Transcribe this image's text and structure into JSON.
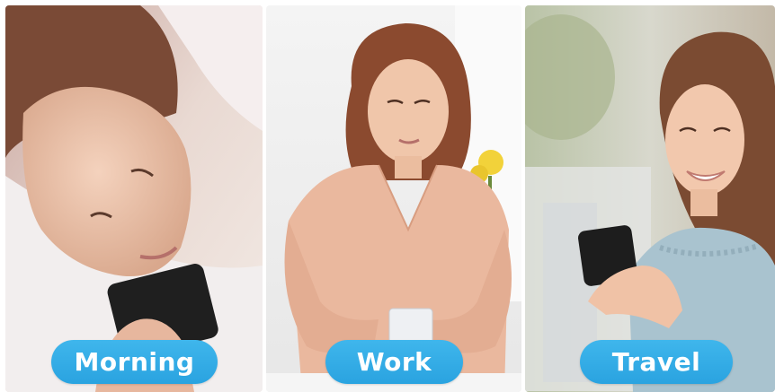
{
  "panels": [
    {
      "id": "morning",
      "label": "Morning",
      "scene": "woman lying in bed looking at phone"
    },
    {
      "id": "work",
      "label": "Work",
      "scene": "woman at desk looking at phone"
    },
    {
      "id": "travel",
      "label": "Travel",
      "scene": "smiling woman outdoors using phone"
    }
  ],
  "colors": {
    "pill": "#2aa3e0",
    "pill_text": "#ffffff"
  }
}
